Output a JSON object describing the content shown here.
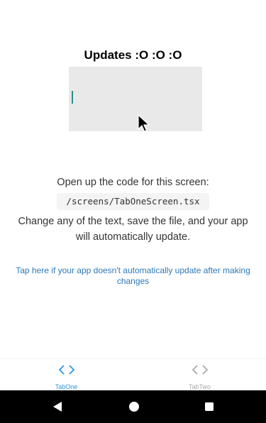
{
  "screen": {
    "title": "Updates :O :O :O",
    "input": {
      "value": ""
    }
  },
  "info": {
    "open_line": "Open up the code for this screen:",
    "path": "/screens/TabOneScreen.tsx",
    "change_line": "Change any of the text, save the file, and your app will automatically update.",
    "help_link": "Tap here if your app doesn't automatically update after making changes"
  },
  "tabs": [
    {
      "label": "TabOne",
      "icon": "code-icon",
      "active": true,
      "color": "#2f95dc"
    },
    {
      "label": "TabTwo",
      "icon": "code-icon",
      "active": false,
      "color": "#aaaaaa"
    }
  ],
  "nav_bar": {
    "buttons": [
      "back-icon",
      "home-icon",
      "recents-icon"
    ]
  },
  "colors": {
    "link": "#2e78b7",
    "active_tab": "#2f95dc",
    "inactive_tab": "#aaaaaa",
    "input_background": "#e9e9e9"
  }
}
